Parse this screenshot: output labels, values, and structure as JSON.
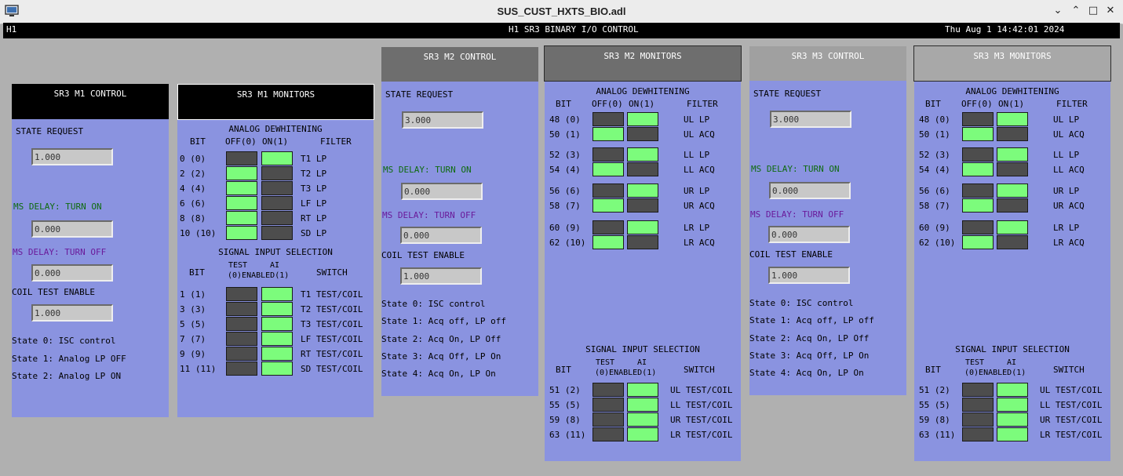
{
  "window": {
    "title": "SUS_CUST_HXTS_BIO.adl",
    "icon": "monitor-icon",
    "min": "⌄",
    "max": "⌃",
    "restore": "□",
    "close": "✕"
  },
  "topbar": {
    "site": "H1",
    "title": "H1 SR3 BINARY I/O CONTROL",
    "datetime": "Thu Aug  1 14:42:01 2024"
  },
  "labels": {
    "state_request": "STATE REQUEST",
    "ms_turn_on": "MS DELAY: TURN ON",
    "ms_turn_off": "MS DELAY: TURN OFF",
    "coil_test": "COIL TEST ENABLE",
    "analog_dewhitening": "ANALOG DEWHITENING",
    "signal_input_selection": "SIGNAL INPUT SELECTION",
    "bit": "BIT",
    "off0": "OFF(0)",
    "on1": "ON(1)",
    "filter": "FILTER",
    "test": "TEST",
    "ai": "AI",
    "enabled_line": "(0)ENABLED(1)",
    "switch": "SWITCH"
  },
  "m1_control": {
    "title": "SR3 M1 CONTROL",
    "state_request": "1.000",
    "ms_on": "0.000",
    "ms_off": "0.000",
    "coil": "1.000",
    "states": [
      "State 0: ISC control",
      "State 1: Analog LP OFF",
      "State 2: Analog LP ON"
    ]
  },
  "m1_monitors": {
    "title": "SR3 M1 MONITORS",
    "dewhitening": [
      {
        "bit": "0 (0)",
        "off": false,
        "on": true,
        "filter": "T1 LP"
      },
      {
        "bit": "2 (2)",
        "off": true,
        "on": false,
        "filter": "T2 LP"
      },
      {
        "bit": "4 (4)",
        "off": true,
        "on": false,
        "filter": "T3 LP"
      },
      {
        "bit": "6 (6)",
        "off": true,
        "on": false,
        "filter": "LF LP"
      },
      {
        "bit": "8 (8)",
        "off": true,
        "on": false,
        "filter": "RT LP"
      },
      {
        "bit": "10 (10)",
        "off": true,
        "on": false,
        "filter": "SD LP"
      }
    ],
    "signal": [
      {
        "bit": "1 (1)",
        "test": false,
        "ai": true,
        "switch": "T1 TEST/COIL"
      },
      {
        "bit": "3 (3)",
        "test": false,
        "ai": true,
        "switch": "T2 TEST/COIL"
      },
      {
        "bit": "5 (5)",
        "test": false,
        "ai": true,
        "switch": "T3 TEST/COIL"
      },
      {
        "bit": "7 (7)",
        "test": false,
        "ai": true,
        "switch": "LF TEST/COIL"
      },
      {
        "bit": "9 (9)",
        "test": false,
        "ai": true,
        "switch": "RT TEST/COIL"
      },
      {
        "bit": "11 (11)",
        "test": false,
        "ai": true,
        "switch": "SD TEST/COIL"
      }
    ]
  },
  "m2_control": {
    "title": "SR3 M2 CONTROL",
    "state_request": "3.000",
    "ms_on": "0.000",
    "ms_off": "0.000",
    "coil": "1.000",
    "states": [
      "State 0: ISC control",
      "State 1: Acq off, LP off",
      "State 2: Acq On, LP Off",
      "State 3: Acq Off, LP On",
      "State 4: Acq On, LP On"
    ]
  },
  "m2_monitors": {
    "title": "SR3 M2 MONITORS",
    "dewhitening": [
      {
        "bit": "48 (0)",
        "off": false,
        "on": true,
        "filter": "UL LP"
      },
      {
        "bit": "50 (1)",
        "off": true,
        "on": false,
        "filter": "UL ACQ"
      },
      {
        "bit": "52 (3)",
        "off": false,
        "on": true,
        "filter": "LL LP"
      },
      {
        "bit": "54 (4)",
        "off": true,
        "on": false,
        "filter": "LL ACQ"
      },
      {
        "bit": "56 (6)",
        "off": false,
        "on": true,
        "filter": "UR LP"
      },
      {
        "bit": "58 (7)",
        "off": true,
        "on": false,
        "filter": "UR ACQ"
      },
      {
        "bit": "60 (9)",
        "off": false,
        "on": true,
        "filter": "LR LP"
      },
      {
        "bit": "62 (10)",
        "off": true,
        "on": false,
        "filter": "LR ACQ"
      }
    ],
    "signal": [
      {
        "bit": "51 (2)",
        "test": false,
        "ai": true,
        "switch": "UL TEST/COIL"
      },
      {
        "bit": "55 (5)",
        "test": false,
        "ai": true,
        "switch": "LL TEST/COIL"
      },
      {
        "bit": "59 (8)",
        "test": false,
        "ai": true,
        "switch": "UR TEST/COIL"
      },
      {
        "bit": "63 (11)",
        "test": false,
        "ai": true,
        "switch": "LR TEST/COIL"
      }
    ]
  },
  "m3_control": {
    "title": "SR3 M3 CONTROL",
    "state_request": "3.000",
    "ms_on": "0.000",
    "ms_off": "0.000",
    "coil": "1.000",
    "states": [
      "State 0: ISC control",
      "State 1: Acq off, LP off",
      "State 2: Acq On, LP Off",
      "State 3: Acq Off, LP On",
      "State 4: Acq On, LP On"
    ]
  },
  "m3_monitors": {
    "title": "SR3 M3 MONITORS",
    "dewhitening": [
      {
        "bit": "48 (0)",
        "off": false,
        "on": true,
        "filter": "UL LP"
      },
      {
        "bit": "50 (1)",
        "off": true,
        "on": false,
        "filter": "UL ACQ"
      },
      {
        "bit": "52 (3)",
        "off": false,
        "on": true,
        "filter": "LL LP"
      },
      {
        "bit": "54 (4)",
        "off": true,
        "on": false,
        "filter": "LL ACQ"
      },
      {
        "bit": "56 (6)",
        "off": false,
        "on": true,
        "filter": "UR LP"
      },
      {
        "bit": "58 (7)",
        "off": true,
        "on": false,
        "filter": "UR ACQ"
      },
      {
        "bit": "60 (9)",
        "off": false,
        "on": true,
        "filter": "LR LP"
      },
      {
        "bit": "62 (10)",
        "off": true,
        "on": false,
        "filter": "LR ACQ"
      }
    ],
    "signal": [
      {
        "bit": "51 (2)",
        "test": false,
        "ai": true,
        "switch": "UL TEST/COIL"
      },
      {
        "bit": "55 (5)",
        "test": false,
        "ai": true,
        "switch": "LL TEST/COIL"
      },
      {
        "bit": "59 (8)",
        "test": false,
        "ai": true,
        "switch": "UR TEST/COIL"
      },
      {
        "bit": "63 (11)",
        "test": false,
        "ai": true,
        "switch": "LR TEST/COIL"
      }
    ]
  },
  "colors": {
    "panel": "#8a93e0",
    "led_on": "#7cfc7c",
    "led_off": "#4d4d4d",
    "green_label": "#0e6b0e",
    "purple_label": "#6a1a9a"
  }
}
